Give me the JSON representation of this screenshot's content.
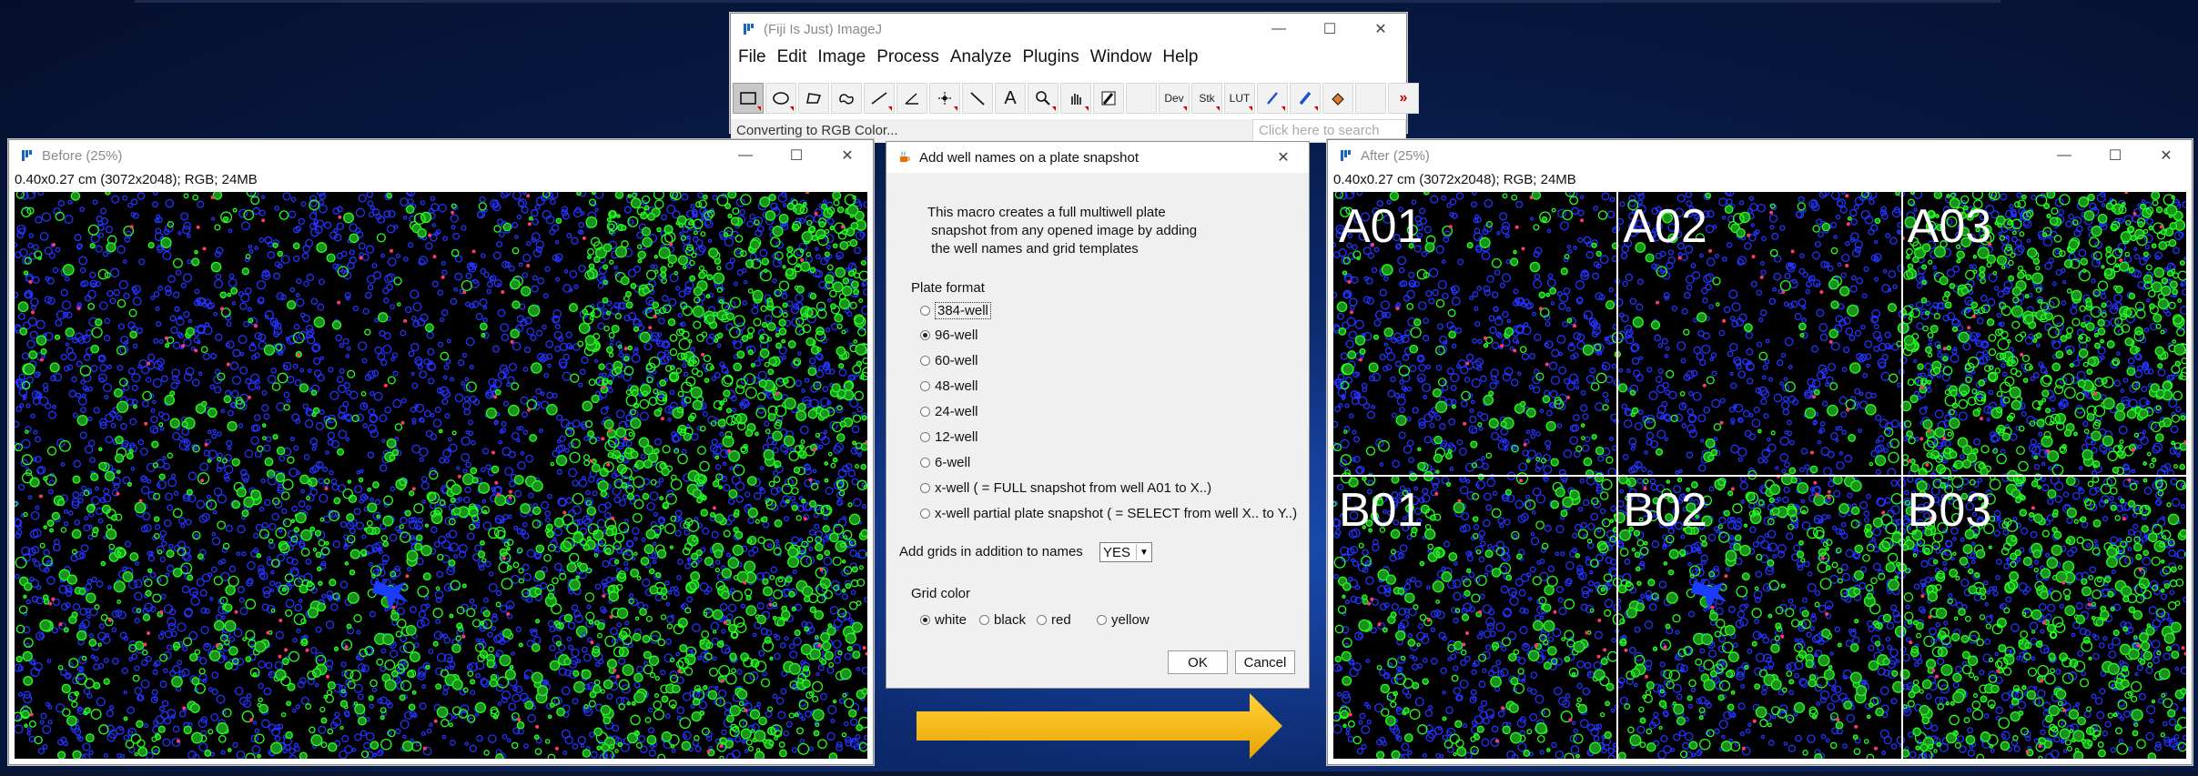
{
  "imagej": {
    "title": "(Fiji Is Just) ImageJ",
    "menus": [
      "File",
      "Edit",
      "Image",
      "Process",
      "Analyze",
      "Plugins",
      "Window",
      "Help"
    ],
    "tools": [
      {
        "name": "rectangle-tool-icon"
      },
      {
        "name": "oval-tool-icon"
      },
      {
        "name": "polygon-tool-icon"
      },
      {
        "name": "freehand-tool-icon"
      },
      {
        "name": "line-tool-icon"
      },
      {
        "name": "angle-tool-icon"
      },
      {
        "name": "point-tool-icon"
      },
      {
        "name": "wand-tool-icon"
      },
      {
        "name": "text-tool-icon"
      },
      {
        "name": "magnifier-tool-icon"
      },
      {
        "name": "hand-tool-icon"
      },
      {
        "name": "dropper-tool-icon"
      },
      {
        "name": "blank-tool"
      },
      {
        "name": "dev-tool",
        "label": "Dev"
      },
      {
        "name": "stk-tool",
        "label": "Stk"
      },
      {
        "name": "lut-tool",
        "label": "LUT"
      },
      {
        "name": "pencil-tool-icon"
      },
      {
        "name": "brush-tool-icon"
      },
      {
        "name": "flood-fill-tool-icon"
      },
      {
        "name": "blank-tool"
      },
      {
        "name": "more-tools-icon"
      }
    ],
    "status": "Converting to RGB Color...",
    "search_placeholder": "Click here to search"
  },
  "before_window": {
    "title": "Before (25%)",
    "info": "0.40x0.27 cm (3072x2048); RGB; 24MB"
  },
  "after_window": {
    "title": "After (25%)",
    "info": "0.40x0.27 cm (3072x2048); RGB; 24MB",
    "wells": [
      "A01",
      "A02",
      "A03",
      "B01",
      "B02",
      "B03"
    ]
  },
  "dialog": {
    "title": "Add well names on a plate snapshot",
    "description": "This macro creates a full multiwell plate\n snapshot from any opened image by adding\n the well names and grid templates",
    "plate_format_label": "Plate format",
    "plate_formats": [
      "384-well",
      "96-well",
      "60-well",
      "48-well",
      "24-well",
      "12-well",
      "6-well",
      "x-well ( = FULL snapshot from well A01 to X..)",
      "x-well partial plate snapshot ( = SELECT from well X.. to Y..)"
    ],
    "plate_format_selected": "96-well",
    "grids_label": "Add grids in addition to names",
    "grids_value": "YES",
    "grid_color_label": "Grid color",
    "grid_colors": [
      "white",
      "black",
      "red",
      "yellow"
    ],
    "grid_color_selected": "white",
    "ok_label": "OK",
    "cancel_label": "Cancel"
  },
  "colors": {
    "desktop": "#0d2a6e",
    "arrow": "#f5b800",
    "cells_blue": "#2433ff",
    "cells_green": "#22ff22",
    "grid": "#ffffff"
  }
}
